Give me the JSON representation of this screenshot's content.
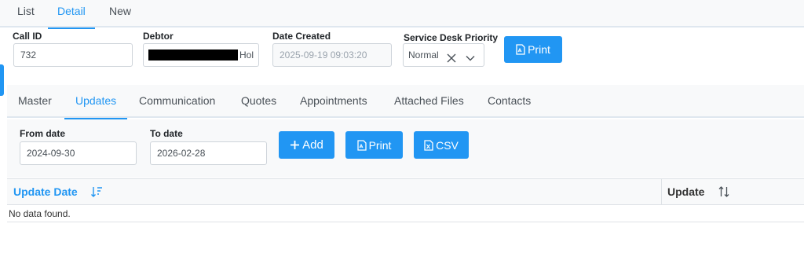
{
  "top_tabs": [
    "List",
    "Detail",
    "New"
  ],
  "header": {
    "call_id_label": "Call ID",
    "call_id_value": "732",
    "debtor_label": "Debtor",
    "debtor_value_visible": "Hol",
    "date_created_label": "Date Created",
    "date_created_value": "2025-09-19 09:03:20",
    "priority_label": "Service Desk Priority",
    "priority_value": "Normal",
    "print_label": "Print"
  },
  "detail_tabs": [
    "Master",
    "Updates",
    "Communication",
    "Quotes",
    "Appointments",
    "Attached Files",
    "Contacts"
  ],
  "filters": {
    "from_label": "From date",
    "from_value": "2024-09-30",
    "to_label": "To date",
    "to_value": "2026-02-28",
    "add_label": "Add",
    "print_label": "Print",
    "csv_label": "CSV"
  },
  "table": {
    "columns": [
      "Update Date",
      "Update"
    ],
    "empty_message": "No data found."
  },
  "colors": {
    "accent": "#2196f3",
    "panel": "#f8f9fa",
    "border": "#dee2e6"
  }
}
